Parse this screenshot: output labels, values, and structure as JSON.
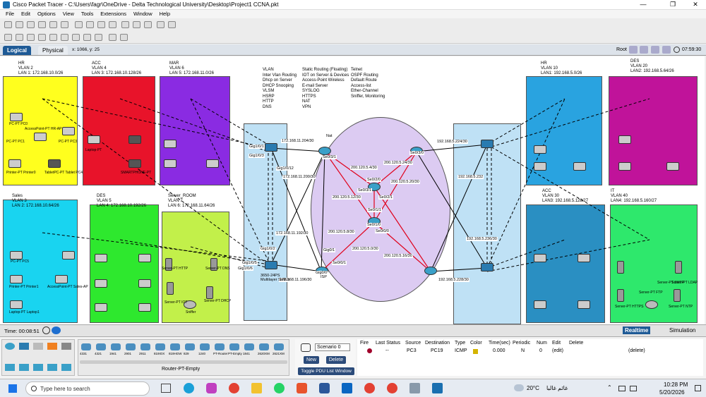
{
  "window": {
    "title": "Cisco Packet Tracer - C:\\Users\\fagr\\OneDrive - Delta Technological University\\Desktop\\Project1 CCNA.pkt"
  },
  "menu": [
    "File",
    "Edit",
    "Options",
    "View",
    "Tools",
    "Extensions",
    "Window",
    "Help"
  ],
  "nav": {
    "logical": "Logical",
    "physical": "Physical",
    "coords": "x: 1066, y: 25",
    "root": "Root",
    "clock": "07:59:30"
  },
  "zones": {
    "hr": [
      "HR",
      "VLAN 2",
      "LAN 1: 172.168.10.0/26"
    ],
    "acc": [
      "ACC",
      "VLAN 4",
      "LAN 3: 172.168.10.128/26"
    ],
    "mar": [
      "MAR",
      "VLAN 6",
      "LAN 5: 172.168.11.0/26"
    ],
    "sales": [
      "Sales",
      "VLAN 3",
      "LAN 2: 172.168.10.64/26"
    ],
    "des": [
      "DES",
      "VLAN 5",
      "LAN 4: 172.168.10.192/26"
    ],
    "server": [
      "Server_ROOM",
      "VLAN 7",
      "LAN 6: 172.168.11.64/26"
    ],
    "hr2": [
      "HR",
      "VLAN 10",
      "LAN1: 192.168.5.0/26"
    ],
    "des2": [
      "DES",
      "VLAN 20",
      "LAN2: 192.168.5.64/26"
    ],
    "acc2": [
      "ACC",
      "VLAN 30",
      "LAN3: 192.168.5.128/27"
    ],
    "it": [
      "IT",
      "VLAN 40",
      "LAN4: 192.168.5.160/27"
    ]
  },
  "features": {
    "col1": [
      "VLAN",
      "Inter Vlan Routing",
      "Dhcp on Server",
      "DHCP Snooping",
      "VLSM",
      "HSRP",
      "HTTP",
      "DNS"
    ],
    "col2": [
      "Static Routing (Floating)",
      "IOT on Server & Devices",
      "Access-Point Wireless",
      "E-mail Server",
      "SYSLOG",
      "HTTPS",
      "NAT",
      "VPN"
    ],
    "col3": [
      "Telnet",
      "OSPF Routing",
      "Default Route",
      "Access-list",
      "Ether-Channel",
      "Sniffer, Monitoring"
    ]
  },
  "labels": {
    "nat": "Nat",
    "ms_top": "Gig1/0/2",
    "ms_bottom": "3650-24PS\nMultilayer Switch",
    "isp_left": "Gig0/1",
    "isp": "ISP",
    "cloud_links": [
      "200.120.5.4/30",
      "200.120.5.24/30",
      "200.120.5.20/30",
      "200.120.5.12/30",
      "200.120.5.8/30",
      "200.120.5.0/30",
      "200.120.5.16/30"
    ],
    "left_ips": [
      "172.168.11.204/30",
      "172.168.11.200/30",
      "172.168.11.192/30",
      "172.168.11.196/30"
    ],
    "right_ips": [
      "192.168.5.224/30",
      "192.168.5.232",
      "192.168.5.236/30",
      "192.168.5.228/30"
    ],
    "ports": [
      "Se0/3/1",
      "Se0/2/0",
      "Se0/2/1",
      "Se0/3/0",
      "Se0/1/1",
      "Se0/1/0",
      "Se0/3/1",
      "Se0/0/1",
      "Se0/0/0",
      "Gig0/1",
      "Gig0/0",
      "Gig1/0/1",
      "Gig1/0/3",
      "Gig1/0/12",
      "Gig1/0/5",
      "Gig1/0/6"
    ],
    "devices": [
      "PC-PT PC0",
      "PC-PT PC1",
      "PC-PT PC3",
      "AccessPoint-PT HR-AP",
      "Printer-PT Printer0",
      "TabletPC-PT Tablet PC4",
      "Laptop-PT",
      "SMARTPHONE-PT",
      "PC-PT PC5",
      "Printer-PT Printer1",
      "AccessPoint-PT Sales-AP",
      "Laptop-PT Laptop1",
      "Server-PT HTTP",
      "Server-PT DNS",
      "Server-PT DHCP",
      "Server-PT IOT",
      "Sniffer",
      "Server-PT NTP",
      "Server-PT FTP",
      "Server-PT SMTP",
      "Server-PT LDAP",
      "Server-PT HTTPS"
    ]
  },
  "statusbar": {
    "time": "Time: 00:08:51",
    "realtime": "Realtime",
    "simulation": "Simulation"
  },
  "bottom": {
    "device_models": [
      "4331",
      "4321",
      "1941",
      "2901",
      "2911",
      "819IOX",
      "819HGW",
      "829",
      "1240",
      "PT-Router",
      "PT-Empty",
      "1841",
      "2620XM",
      "2621XM"
    ],
    "device_selected": "Router-PT-Empty",
    "scenario": "Scenario 0",
    "new": "New",
    "delete": "Delete",
    "toggle": "Toggle PDU List Window",
    "table_headers": [
      "Fire",
      "Last Status",
      "Source",
      "Destination",
      "Type",
      "Color",
      "Time(sec)",
      "Periodic",
      "Num",
      "Edit",
      "Delete"
    ],
    "row": {
      "status": "--",
      "source": "PC3",
      "destination": "PC19",
      "type": "ICMP",
      "time": "0.000",
      "periodic": "N",
      "num": "0",
      "edit": "(edit)",
      "delete": "(delete)"
    },
    "pdu_color": "#d4b400"
  },
  "taskbar": {
    "search": "Type here to search",
    "weather_temp": "20°C",
    "weather_text": "غائم غالبا",
    "time": "10:28 PM",
    "date": "5/20/2026"
  }
}
